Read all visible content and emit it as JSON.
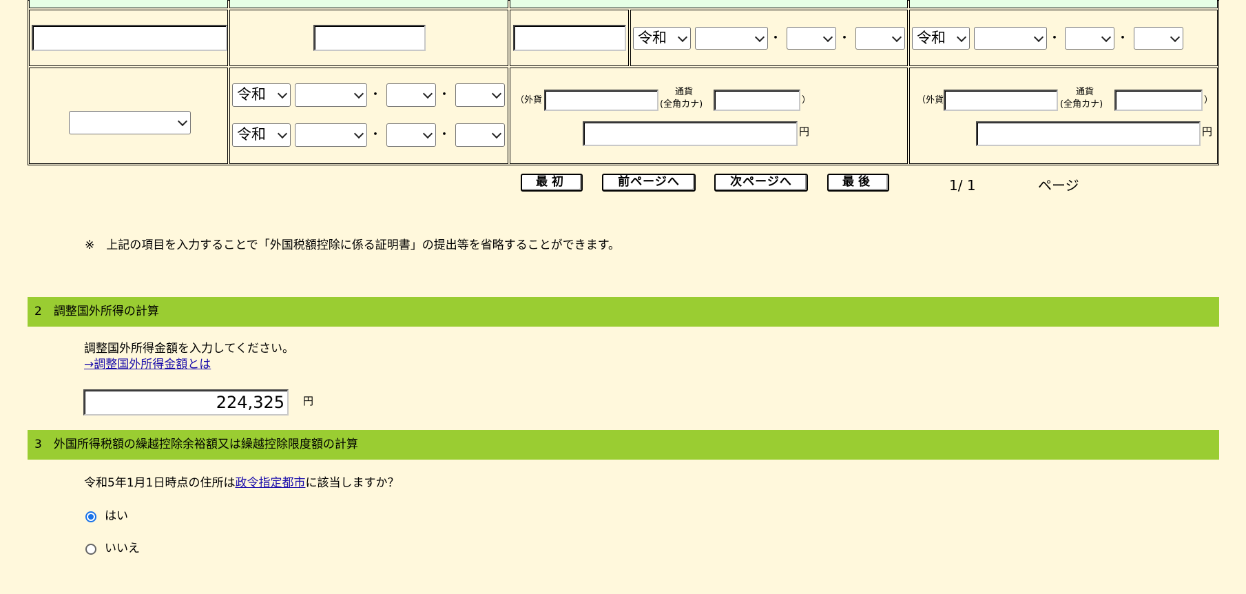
{
  "era_select_value": "令和",
  "dot_separator": "・",
  "yen_label": "円",
  "foreign_currency_label": "（外貨",
  "currency_label_line1": "通貨",
  "currency_label_line2": "(全角カナ)",
  "close_paren": "）",
  "pagination": {
    "first_label": "最初",
    "prev_label": "前ページへ",
    "next_label": "次ページへ",
    "last_label": "最後",
    "page_indicator": "1/ 1",
    "page_suffix": "ページ"
  },
  "note_text": "※　上記の項目を入力することで「外国税額控除に係る証明書」の提出等を省略することができます。",
  "section2": {
    "title": "2　調整国外所得の計算",
    "instruction": "調整国外所得金額を入力してください。",
    "help_link": "→調整国外所得金額とは",
    "amount_value": "224,325",
    "amount_unit": "円"
  },
  "section3": {
    "title": "3　外国所得税額の繰越控除余裕額又は繰越控除限度額の計算",
    "question_prefix": "令和5年1月1日時点の住所は",
    "question_link": "政令指定都市",
    "question_suffix": "に該当しますか？",
    "options": [
      {
        "label": "はい",
        "selected": true
      },
      {
        "label": "いいえ",
        "selected": false
      }
    ]
  },
  "colors": {
    "page_bg": "#fff8dc",
    "header_cell_bg": "#e6ffe6",
    "section_bar_bg": "#9acd32",
    "link": "#1a0dab",
    "radio_selected": "#1a73e8"
  }
}
